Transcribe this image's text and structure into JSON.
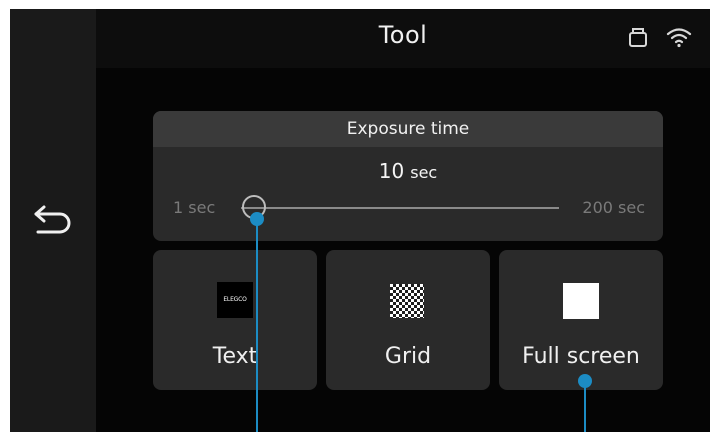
{
  "header": {
    "title": "Tool"
  },
  "status_icons": [
    "storage-icon",
    "wifi-icon"
  ],
  "nav": {
    "back_icon": "return-arrow-icon"
  },
  "exposure": {
    "title": "Exposure time",
    "value": "10",
    "unit": "sec",
    "min_label": "1 sec",
    "max_label": "200 sec"
  },
  "tiles": [
    {
      "label": "Text",
      "icon": "elegco-logo-icon",
      "logo_text": "ELEGCO"
    },
    {
      "label": "Grid",
      "icon": "checkerboard-icon"
    },
    {
      "label": "Full screen",
      "icon": "white-square-icon"
    }
  ],
  "colors": {
    "background": "#050505",
    "panel": "#2a2a2a",
    "panel_header": "#3a3a3a",
    "annotation": "#1c8cc4"
  }
}
